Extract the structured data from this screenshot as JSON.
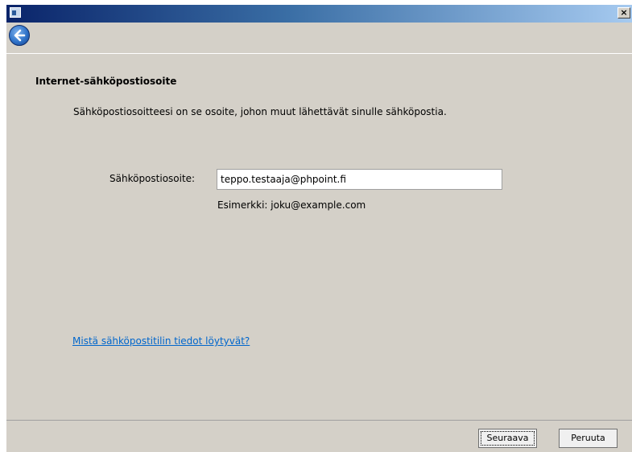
{
  "window": {
    "title": "",
    "close_glyph": "×"
  },
  "page": {
    "heading": "Internet-sähköpostiosoite",
    "description": "Sähköpostiosoitteesi on se osoite, johon muut lähettävät sinulle sähköpostia.",
    "email_label": "Sähköpostiosoite:",
    "email_value": "teppo.testaaja@phpoint.fi",
    "example": "Esimerkki: joku@example.com",
    "help_link": "Mistä sähköpostitilin tiedot löytyvät?"
  },
  "buttons": {
    "next": "Seuraava",
    "cancel": "Peruuta"
  },
  "icons": {
    "back": "back-arrow-icon",
    "app": "app-icon",
    "close": "close-icon"
  },
  "colors": {
    "titlebar_start": "#0a246a",
    "titlebar_end": "#a6caf0",
    "dialog_bg": "#d4d0c8",
    "link": "#0066cc"
  }
}
